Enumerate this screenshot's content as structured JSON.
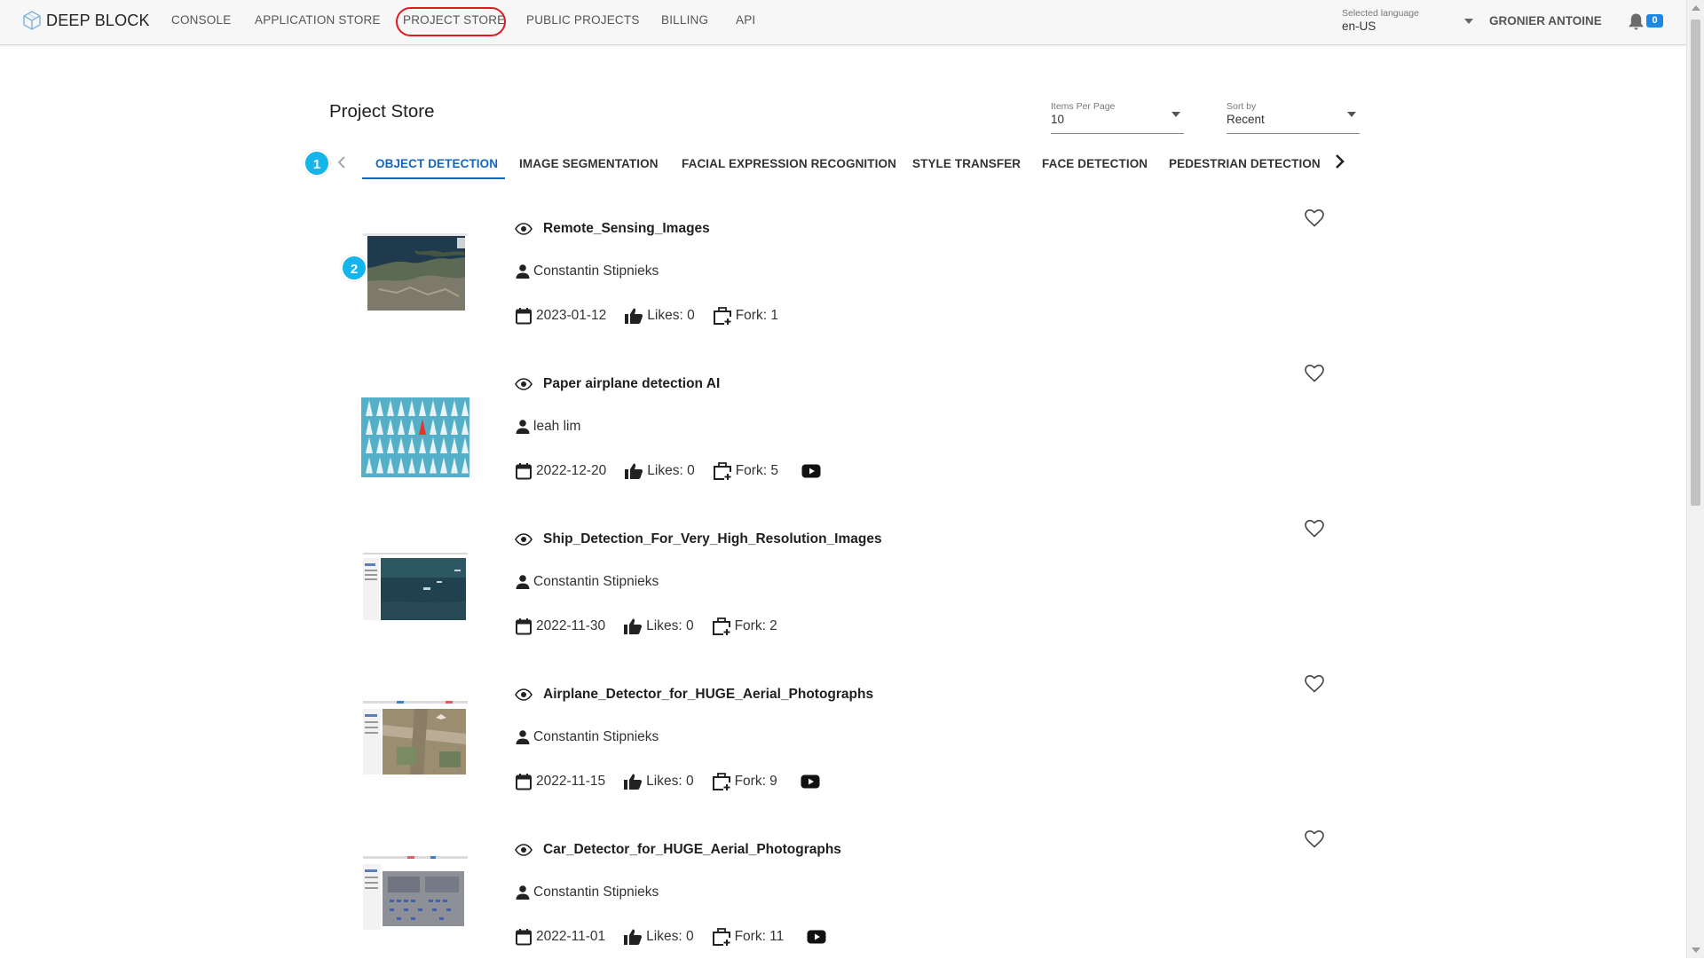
{
  "app": {
    "logo_text": "DEEP BLOCK"
  },
  "nav": {
    "items": [
      {
        "label": "CONSOLE"
      },
      {
        "label": "APPLICATION STORE"
      },
      {
        "label": "PROJECT STORE",
        "highlighted": true
      },
      {
        "label": "PUBLIC PROJECTS"
      },
      {
        "label": "BILLING"
      },
      {
        "label": "API"
      }
    ],
    "highlight_color": "#e2191e"
  },
  "language": {
    "label": "Selected language",
    "value": "en-US"
  },
  "user": {
    "name": "GRONIER ANTOINE",
    "notification_count": "0"
  },
  "page": {
    "title": "Project Store",
    "items_per_page": {
      "label": "Items Per Page",
      "value": "10"
    },
    "sort_by": {
      "label": "Sort by",
      "value": "Recent"
    }
  },
  "tabs": {
    "step_badge": "1",
    "items": [
      {
        "label": "OBJECT DETECTION",
        "active": true
      },
      {
        "label": "IMAGE SEGMENTATION"
      },
      {
        "label": "FACIAL EXPRESSION RECOGNITION"
      },
      {
        "label": "STYLE TRANSFER"
      },
      {
        "label": "FACE DETECTION"
      },
      {
        "label": "PEDESTRIAN DETECTION"
      }
    ],
    "active_color": "#1565c0"
  },
  "projects": [
    {
      "title": "Remote_Sensing_Images",
      "author": "Constantin Stipnieks",
      "date": "2023-01-12",
      "likes": "Likes: 0",
      "fork": "Fork: 1",
      "youtube": false,
      "step_badge": "2"
    },
    {
      "title": "Paper airplane detection AI",
      "author": "leah lim",
      "date": "2022-12-20",
      "likes": "Likes: 0",
      "fork": "Fork: 5",
      "youtube": true
    },
    {
      "title": "Ship_Detection_For_Very_High_Resolution_Images",
      "author": "Constantin Stipnieks",
      "date": "2022-11-30",
      "likes": "Likes: 0",
      "fork": "Fork: 2",
      "youtube": false
    },
    {
      "title": "Airplane_Detector_for_HUGE_Aerial_Photographs",
      "author": "Constantin Stipnieks",
      "date": "2022-11-15",
      "likes": "Likes: 0",
      "fork": "Fork: 9",
      "youtube": true
    },
    {
      "title": "Car_Detector_for_HUGE_Aerial_Photographs",
      "author": "Constantin Stipnieks",
      "date": "2022-11-01",
      "likes": "Likes: 0",
      "fork": "Fork: 11",
      "youtube": true
    }
  ],
  "icons": {
    "view": "eye-icon",
    "author": "person-icon",
    "date": "calendar-icon",
    "likes": "thumb-up-icon",
    "fork": "fork-icon",
    "video": "youtube-icon",
    "favorite": "heart-outline-icon"
  }
}
